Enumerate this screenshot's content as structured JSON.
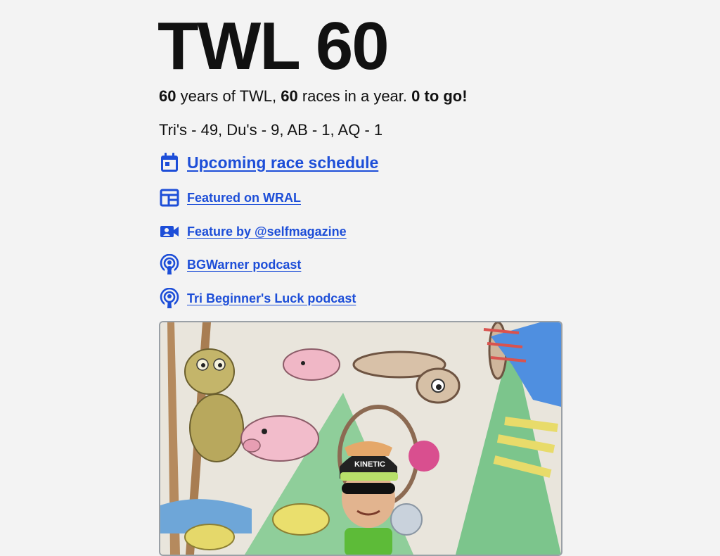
{
  "header": {
    "title": "TWL 60"
  },
  "tagline": {
    "num1": "60",
    "text1": " years of TWL, ",
    "num2": "60",
    "text2": " races in a year. ",
    "togo": "0 to go!"
  },
  "tally": "Tri's - 49, Du's - 9, AB - 1, AQ - 1",
  "links": [
    {
      "label": "Upcoming race schedule",
      "icon": "calendar-icon"
    },
    {
      "label": "Featured on WRAL",
      "icon": "newspaper-icon"
    },
    {
      "label": "Feature by @selfmagazine",
      "icon": "video-camera-icon"
    },
    {
      "label": "BGWarner podcast",
      "icon": "podcast-icon"
    },
    {
      "label": "Tri Beginner's Luck podcast",
      "icon": "podcast-icon"
    }
  ],
  "photo": {
    "cap_text": "KINETIC"
  },
  "colors": {
    "link": "#1d4ed8",
    "background": "#f3f3f3"
  }
}
